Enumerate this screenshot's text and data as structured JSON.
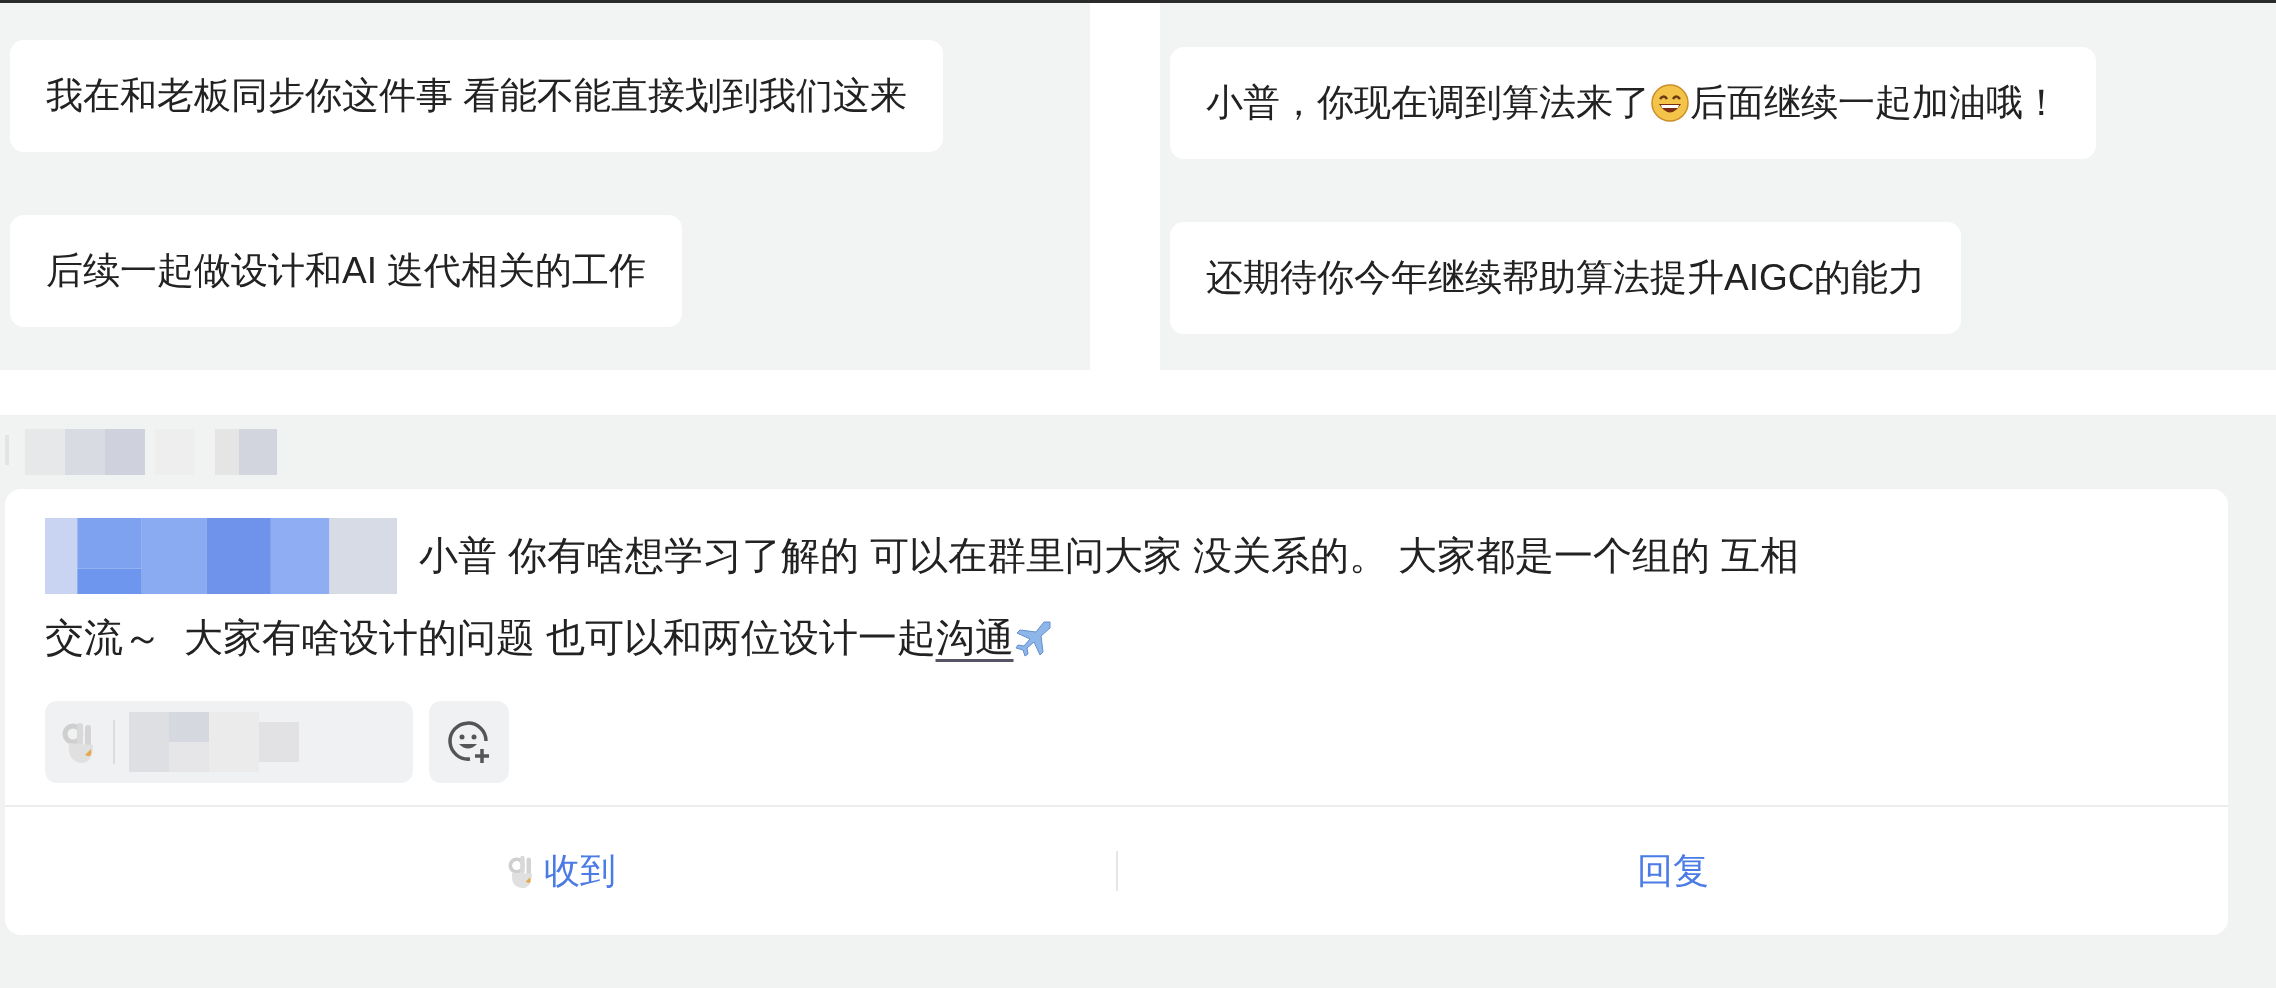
{
  "left_messages": [
    {
      "text": "我在和老板同步你这件事 看能不能直接划到我们这来"
    },
    {
      "text": "后续一起做设计和AI 迭代相关的工作"
    }
  ],
  "right_messages": [
    {
      "text": "小普，你现在调到算法来了",
      "text_after_emoji": "后面继续一起加油哦！"
    },
    {
      "text": "还期待你今年继续帮助算法提升AIGC的能力"
    }
  ],
  "post": {
    "message": {
      "text": "小普 你有啥想学习了解的 可以在群里问大家 没关系的。 大家都是一个组的 互相",
      "text_line_2": "交流～  大家有啥设计的问题 也可以和两位设计一起",
      "link": "沟通"
    },
    "actions": [
      {
        "label": "收到",
        "kind": "reaction"
      },
      {
        "label": "回复",
        "kind": "reply"
      }
    ]
  }
}
